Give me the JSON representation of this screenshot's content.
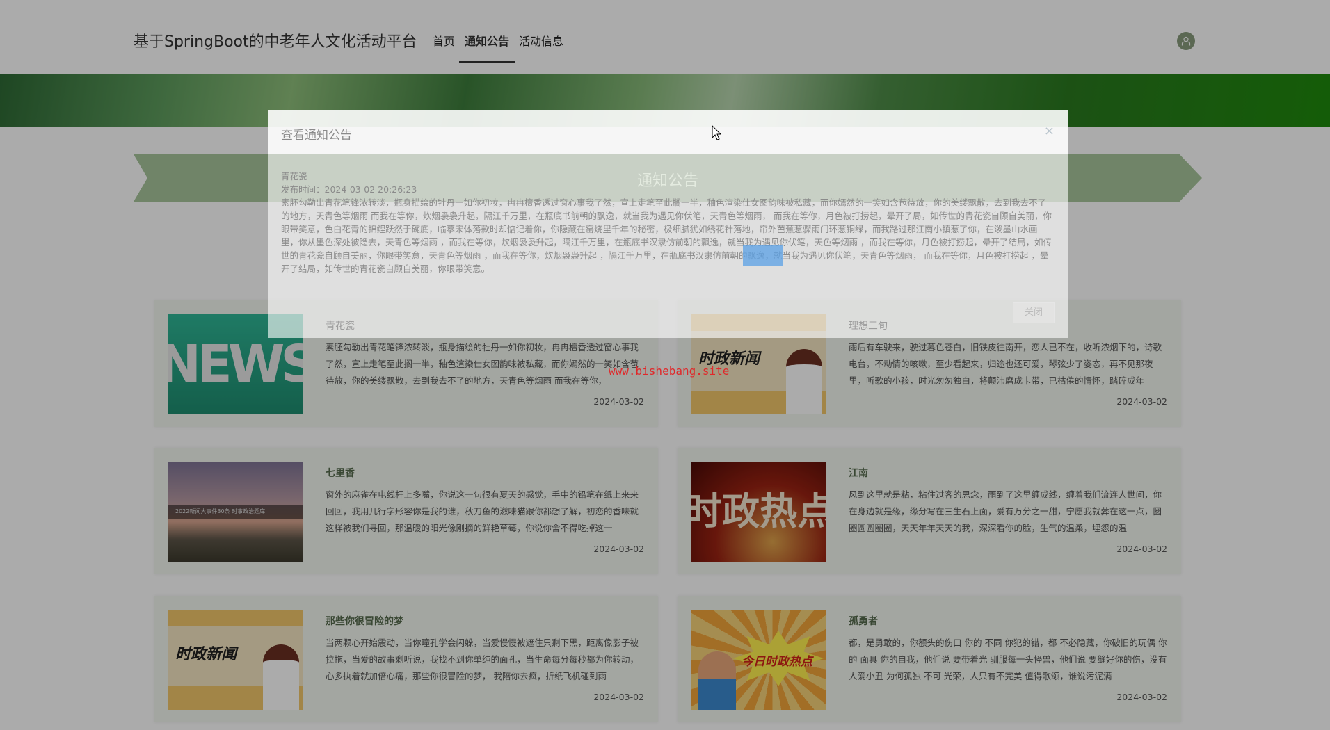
{
  "header": {
    "title": "基于SpringBoot的中老年人文化活动平台",
    "nav": [
      {
        "label": "首页"
      },
      {
        "label": "通知公告"
      },
      {
        "label": "活动信息"
      }
    ],
    "active_nav": "通知公告",
    "user_icon": "user-icon"
  },
  "section_title": "通知公告",
  "cards": [
    {
      "title": "青花瓷",
      "desc": "素胚勾勒出青花笔锋浓转淡，瓶身描绘的牡丹一如你初妆，冉冉檀香透过窗心事我了然，宣上走笔至此搁一半，釉色渲染仕女图韵味被私藏，而你嫣然的一笑如含苞待放，你的美缕飘散，去到我去不了的地方，天青色等烟雨 而我在等你，",
      "date": "2024-03-02",
      "image_text": "NEWS"
    },
    {
      "title": "理想三旬",
      "desc": "雨后有车驶来，驶过暮色苍白，旧铁皮往南开，恋人已不在，收听浓烟下的，诗歌电台，不动情的咳嗽，至少看起来，归途也还可爱，琴弦少了姿态，再不见那夜里，听歌的小孩，时光匆匆独白，将颠沛磨成卡带，已枯倦的情怀，踏碎成年",
      "date": "2024-03-02",
      "image_text": "时政新闻"
    },
    {
      "title": "七里香",
      "desc": "窗外的麻雀在电线杆上多嘴，你说这一句很有夏天的感觉，手中的铅笔在纸上来来回回，我用几行字形容你是我的谁，秋刀鱼的滋味猫跟你都想了解，初恋的香味就这样被我们寻回，那温暖的阳光像刚摘的鲜艳草莓，你说你舍不得吃掉这一",
      "date": "2024-03-02",
      "image_text": "2022新闻大事件30条 时事政治题库"
    },
    {
      "title": "江南",
      "desc": "风到这里就是粘，粘住过客的思念，雨到了这里缠成线，缠着我们流连人世间，你在身边就是缘，缘分写在三生石上面，爱有万分之一甜，宁愿我就葬在这一点，圈圈圆圆圈圈，天天年年天天的我，深深看你的脸，生气的温柔，埋怨的温",
      "date": "2024-03-02",
      "image_text": "时政热点"
    },
    {
      "title": "那些你很冒险的梦",
      "desc": "当两颗心开始震动，当你瞳孔学会闪躲，当爱慢慢被遮住只剩下黑，距离像影子被拉拖，当爱的故事剩听说，我找不到你单纯的面孔，当生命每分每秒都为你转动，心多执着就加倍心痛，那些你很冒险的梦， 我陪你去疯，折纸飞机碰到雨",
      "date": "2024-03-02",
      "image_text": "时政新闻"
    },
    {
      "title": "孤勇者",
      "desc": "都，是勇敢的，你额头的伤口 你的 不同 你犯的错，都 不必隐藏，你破旧的玩偶 你的 面具 你的自我，他们说 要带着光 驯服每一头怪兽，他们说 要缝好你的伤，没有人爱小丑 为何孤独 不可 光荣，人只有不完美 值得歌颂，谁说污泥满",
      "date": "2024-03-02",
      "image_text": "今日时政热点"
    }
  ],
  "modal": {
    "title": "查看通知公告",
    "notice_title": "青花瓷",
    "publish_label": "发布时间：",
    "publish_time": "2024-03-02 20:26:23",
    "content": "素胚勾勒出青花笔锋浓转淡，瓶身描绘的牡丹一如你初妆，冉冉檀香透过窗心事我了然，宣上走笔至此搁一半，釉色渲染仕女图韵味被私藏，而你嫣然的一笑如含苞待放，你的美缕飘散，去到我去不了的地方，天青色等烟雨 而我在等你，炊烟袅袅升起，隔江千万里，在瓶底书前朝的飘逸，就当我为遇见你伏笔，天青色等烟雨， 而我在等你，月色被打捞起，晕开了局，如传世的青花瓷自顾自美丽，你眼带笑意，色白花青的锦鲤跃然于碗底，临摹宋体落款时却惦记着你，你隐藏在窑烧里千年的秘密，极细腻犹如绣花针落地，帘外芭蕉惹骤雨门环惹铜绿，而我路过那江南小镇惹了你，在泼墨山水画里，你从墨色深处被隐去，天青色等烟雨 ，而我在等你，炊烟袅袅升起，隔江千万里，在瓶底书汉隶仿前朝的飘逸，就当我为遇见你伏笔，天色等烟雨 ，而我在等你，月色被打捞起，晕开了结局，如传世的青花瓷自顾自美丽，你眼带笑意，天青色等烟雨 ，而我在等你，炊烟袅袅升起 ，隔江千万里，在瓶底书汉隶仿前朝的飘逸，就当我为遇见你伏笔，天青色等烟雨， 而我在等你，月色被打捞起 ，晕开了结局，如传世的青花瓷自顾自美丽，你眼带笑意。",
    "close_label": "关闭",
    "close_icon": "×"
  },
  "watermark": "www.bishebang.site"
}
